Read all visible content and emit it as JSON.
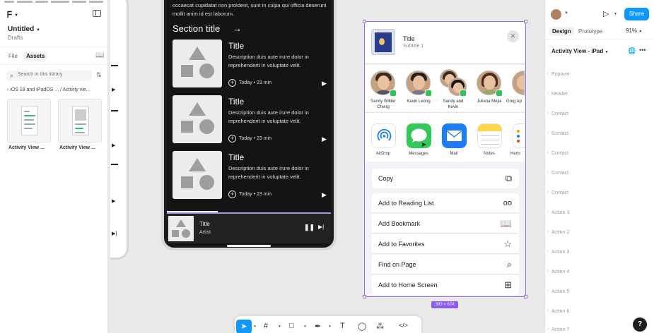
{
  "left_panel": {
    "file_name": "Untitled",
    "file_location": "Drafts",
    "tabs": [
      "File",
      "Assets"
    ],
    "search_placeholder": "Search in this library",
    "breadcrumb": "iOS 18 and iPadOS ...  /  Activity vie...",
    "thumbnails": [
      "Activity View ...",
      "Activity View ..."
    ]
  },
  "phone": {
    "intro_text": "occaecat cupidatat non proident, sunt in culpa qui officia deserunt mollit anim id est laborum.",
    "section_title": "Section title",
    "cards": [
      {
        "title": "Title",
        "description": "Description duis aute irure dolor in reprehenderit in voluptate velit.",
        "meta": "Today • 23 min"
      },
      {
        "title": "Title",
        "description": "Description duis aute irure dolor in reprehenderit in voluptate velit.",
        "meta": "Today • 23 min"
      },
      {
        "title": "Title",
        "description": "Description duis aute irure dolor in reprehenderit in voluptate velit.",
        "meta": "Today • 23 min"
      }
    ],
    "mini_player": {
      "title": "Title",
      "artist": "Artist"
    }
  },
  "share_sheet": {
    "title": "Title",
    "subtitle": "Subtitle 1",
    "people": [
      {
        "name": "Sandy Wilder Cheng"
      },
      {
        "name": "Kevin Leong"
      },
      {
        "name": "Sandy and Kevin"
      },
      {
        "name": "Juliana Mejia"
      },
      {
        "name": "Greg Ap"
      }
    ],
    "apps": [
      {
        "name": "AirDrop",
        "color": "#ffffff"
      },
      {
        "name": "Messages",
        "color": "#34c759"
      },
      {
        "name": "Mail",
        "color": "#1e7cf2"
      },
      {
        "name": "Notes",
        "color": "#ffd64a"
      },
      {
        "name": "Remi",
        "color": "#ffffff"
      }
    ],
    "copy_action": "Copy",
    "actions": [
      "Add to Reading List",
      "Add Bookmark",
      "Add to Favorites",
      "Find on Page",
      "Add to Home Screen"
    ],
    "dimensions": "393 × 674",
    "accent_color": "#9b6dd6"
  },
  "right_panel": {
    "share_label": "Share",
    "tabs": [
      "Design",
      "Prototype"
    ],
    "zoom": "91%",
    "component_name": "Activity View - iPad",
    "layers": [
      "Popover",
      "Header",
      "Contact",
      "Contact",
      "Contact",
      "Contact",
      "Contact",
      "Action 1",
      "Action 2",
      "Action 3",
      "Action 4",
      "Action 5",
      "Action 6",
      "Action 7"
    ],
    "brand_color": "#0d99ff"
  },
  "toolbar": {
    "tools": [
      "move-tool",
      "frame-tool",
      "shape-tool",
      "pen-tool",
      "text-tool",
      "comment-tool",
      "components-tool",
      "dev-mode-tool"
    ]
  }
}
